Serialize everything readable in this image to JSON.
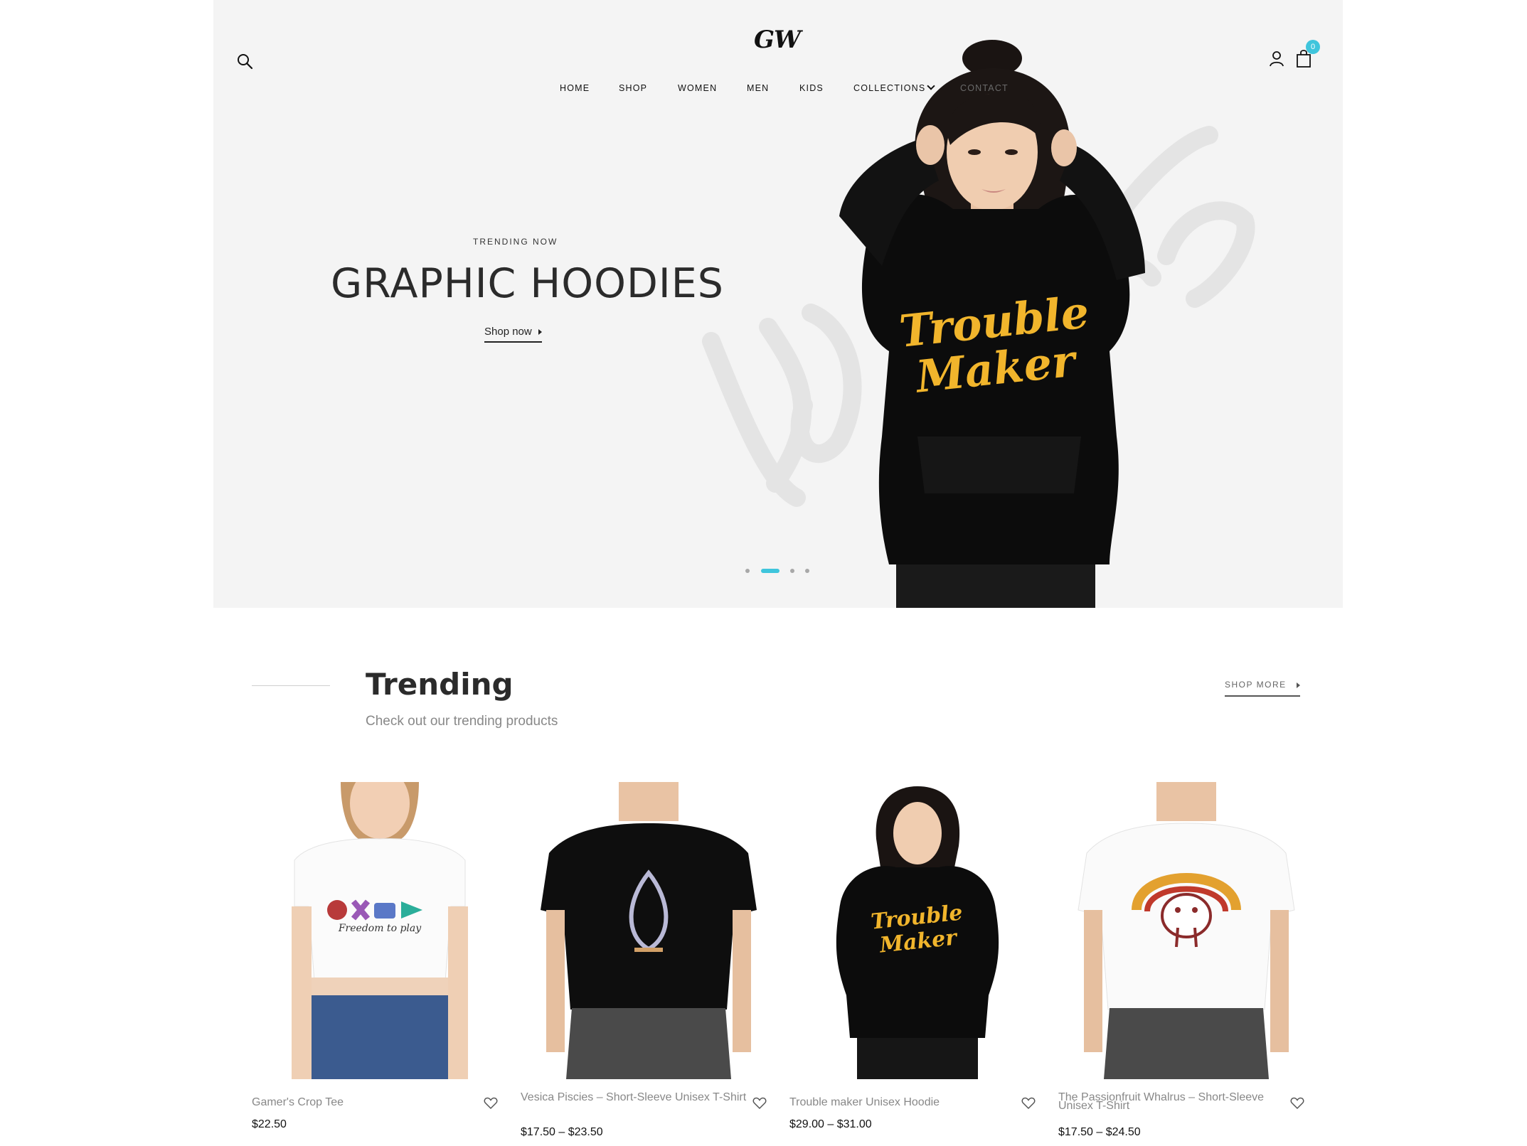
{
  "header": {
    "logo": "GW",
    "cart_count": "0",
    "nav": [
      {
        "label": "HOME"
      },
      {
        "label": "SHOP"
      },
      {
        "label": "WOMEN"
      },
      {
        "label": "MEN"
      },
      {
        "label": "KIDS"
      },
      {
        "label": "COLLECTIONS"
      },
      {
        "label": "CONTACT"
      }
    ]
  },
  "hero": {
    "kicker": "TRENDING NOW",
    "title": "GRAPHIC HOODIES",
    "cta": "Shop now",
    "shirt_text_line1": "Trouble",
    "shirt_text_line2": "Maker",
    "slides_total": 4,
    "active_slide": 2
  },
  "trending": {
    "title": "Trending",
    "subtitle": "Check out our trending products",
    "shop_more": "SHOP MORE",
    "products": [
      {
        "name": "Gamer's Crop Tee",
        "price": "$22.50",
        "graphic": "Freedom to play"
      },
      {
        "name": "Vesica Piscies – Short-Sleeve Unisex T-Shirt",
        "price": "$17.50 – $23.50"
      },
      {
        "name": "Trouble maker Unisex Hoodie",
        "price": "$29.00 – $31.00",
        "graphic_line1": "Trouble",
        "graphic_line2": "Maker"
      },
      {
        "name": "The Passionfruit Whalrus – Short-Sleeve Unisex T-Shirt",
        "price": "$17.50 – $24.50"
      }
    ]
  },
  "colors": {
    "accent": "#3fc5dc",
    "hero_bg": "#f4f4f4",
    "shirt_text": "#f1b52c"
  }
}
